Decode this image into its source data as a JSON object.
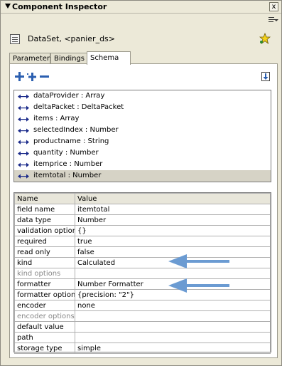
{
  "panel": {
    "title": "Component Inspector",
    "close_label": "x",
    "component_name": "DataSet, <panier_ds>"
  },
  "tabs": [
    {
      "label": "Parameters",
      "active": false
    },
    {
      "label": "Bindings",
      "active": false
    },
    {
      "label": "Schema",
      "active": true
    }
  ],
  "toolbar": {
    "icons": [
      "add-field-icon",
      "add-subfield-icon",
      "remove-field-icon",
      "import-schema-icon"
    ]
  },
  "fields": [
    {
      "label": "dataProvider : Array",
      "selected": false
    },
    {
      "label": "deltaPacket : DeltaPacket",
      "selected": false
    },
    {
      "label": "items : Array",
      "selected": false
    },
    {
      "label": "selectedIndex : Number",
      "selected": false
    },
    {
      "label": "productname : String",
      "selected": false
    },
    {
      "label": "quantity : Number",
      "selected": false
    },
    {
      "label": "itemprice : Number",
      "selected": false
    },
    {
      "label": "itemtotal : Number",
      "selected": true
    }
  ],
  "properties": {
    "headers": [
      "Name",
      "Value"
    ],
    "rows": [
      {
        "name": "field name",
        "value": "itemtotal",
        "disabled": false
      },
      {
        "name": "data type",
        "value": "Number",
        "disabled": false
      },
      {
        "name": "validation options",
        "value": "{}",
        "disabled": false
      },
      {
        "name": "required",
        "value": "true",
        "disabled": false
      },
      {
        "name": "read only",
        "value": "false",
        "disabled": false
      },
      {
        "name": "kind",
        "value": "Calculated",
        "disabled": false
      },
      {
        "name": "kind options",
        "value": "",
        "disabled": true
      },
      {
        "name": "formatter",
        "value": "Number Formatter",
        "disabled": false
      },
      {
        "name": "formatter options",
        "value": "{precision: \"2\"}",
        "disabled": false
      },
      {
        "name": "encoder",
        "value": "none",
        "disabled": false
      },
      {
        "name": "encoder options",
        "value": "",
        "disabled": true
      },
      {
        "name": "default value",
        "value": "",
        "disabled": false
      },
      {
        "name": "path",
        "value": "",
        "disabled": false
      },
      {
        "name": "storage type",
        "value": "simple",
        "disabled": false
      }
    ]
  },
  "colors": {
    "panel_bg": "#ece9d8",
    "selected_row": "#d6d3c6",
    "annotation_arrow": "#6b9bd2",
    "binding_icon": "#1a2a8a"
  }
}
